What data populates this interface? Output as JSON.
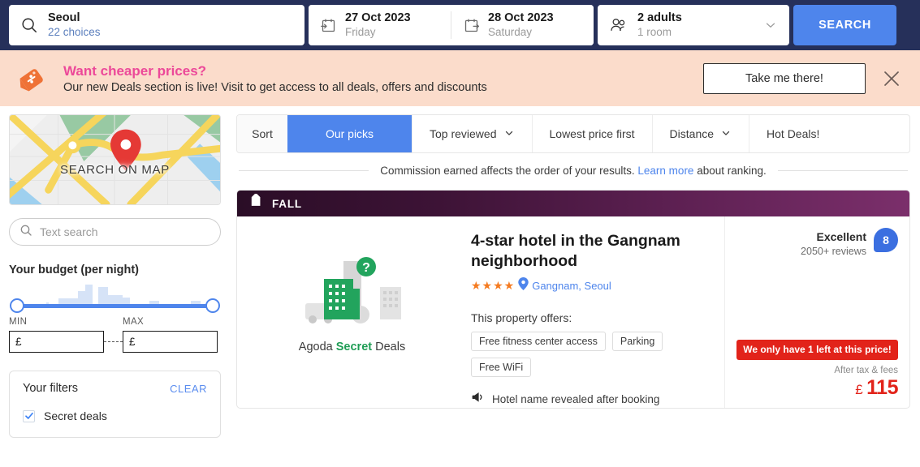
{
  "search_bar": {
    "destination": {
      "icon": "search-icon",
      "value": "Seoul",
      "sub": "22 choices"
    },
    "checkin": {
      "icon": "calendar-checkin-icon",
      "date": "27 Oct 2023",
      "day": "Friday"
    },
    "checkout": {
      "icon": "calendar-checkout-icon",
      "date": "28 Oct 2023",
      "day": "Saturday"
    },
    "occupancy": {
      "icon": "guests-icon",
      "value": "2 adults",
      "sub": "1 room",
      "chevron": "chevron-down-icon"
    },
    "search_button": "SEARCH"
  },
  "promo_banner": {
    "icon": "discount-tag-icon",
    "title": "Want cheaper prices?",
    "subtitle": "Our new Deals section is live! Visit to get access to all deals, offers and discounts",
    "cta": "Take me there!",
    "close": "close-icon",
    "accent_color": "#ec4899",
    "background_color": "#fbdccb"
  },
  "sidebar": {
    "map": {
      "label": "SEARCH ON MAP",
      "pin": "map-pin-icon"
    },
    "text_search": {
      "icon": "search-icon",
      "placeholder": "Text search",
      "value": ""
    },
    "budget": {
      "title": "Your budget (per night)",
      "min_label": "MIN",
      "max_label": "MAX",
      "currency": "£",
      "min_value": "0",
      "max_value": "770",
      "histogram": [
        8,
        8,
        8,
        8,
        8,
        8,
        8,
        8,
        8,
        8,
        8,
        8,
        14,
        8,
        8,
        8,
        8,
        30,
        30,
        30,
        30,
        30,
        30,
        30,
        30,
        55,
        55,
        55,
        80,
        80,
        80,
        8,
        8,
        70,
        70,
        70,
        70,
        40,
        40,
        40,
        40,
        40,
        40,
        32,
        32,
        32,
        8,
        8,
        8,
        8,
        8,
        8,
        8,
        8,
        22,
        22,
        22,
        22,
        8,
        8,
        8,
        8,
        8,
        8,
        8,
        8,
        8,
        8,
        8,
        8,
        8,
        20,
        20,
        20,
        20,
        8,
        8,
        8,
        8,
        8
      ]
    },
    "filters": {
      "title": "Your filters",
      "clear": "CLEAR",
      "items": [
        {
          "label": "Secret deals",
          "checked": true
        }
      ]
    }
  },
  "sort_bar": {
    "label": "Sort",
    "tabs": [
      {
        "label": "Our picks",
        "active": true,
        "dropdown": false
      },
      {
        "label": "Top reviewed",
        "active": false,
        "dropdown": true
      },
      {
        "label": "Lowest price first",
        "active": false,
        "dropdown": false
      },
      {
        "label": "Distance",
        "active": false,
        "dropdown": true
      },
      {
        "label": "Hot Deals!",
        "active": false,
        "dropdown": false
      }
    ]
  },
  "commission_notice": {
    "before": "Commission earned affects the order of your results.",
    "link": "Learn more",
    "after": "about ranking."
  },
  "property": {
    "deal_tag": {
      "icon": "tag-icon",
      "label": "FALL"
    },
    "image": {
      "caption_pre": "Agoda ",
      "caption_bold": "Secret",
      "caption_post": " Deals",
      "icon": "secret-building-icon"
    },
    "title": "4-star hotel in the Gangnam neighborhood",
    "stars": 4,
    "location_icon": "location-pin-icon",
    "location": "Gangnam, Seoul",
    "offers_label": "This property offers:",
    "amenities": [
      "Free fitness center access",
      "Parking",
      "Free WiFi"
    ],
    "reveal_icon": "megaphone-icon",
    "reveal_text": "Hotel name revealed after booking",
    "rating": {
      "word": "Excellent",
      "reviews": "2050+ reviews",
      "score": "8"
    },
    "urgency": "We only have 1 left at this price!",
    "after_tax": "After tax & fees",
    "price_currency": "£",
    "price_amount": "115"
  }
}
